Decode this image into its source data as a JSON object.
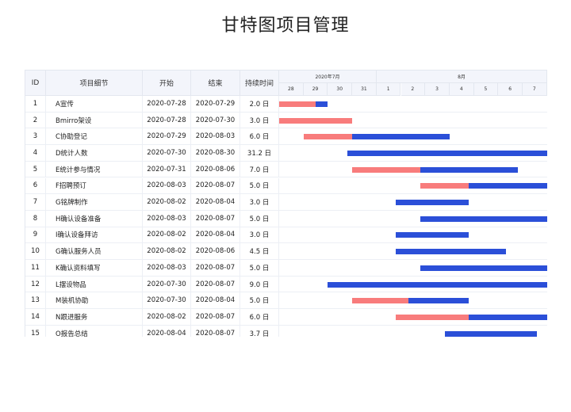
{
  "title": "甘特图项目管理",
  "columns": {
    "id": "ID",
    "detail": "项目细节",
    "start": "开始",
    "end": "结束",
    "duration": "持续时间"
  },
  "timeline": {
    "months": [
      {
        "label": "2020年7月",
        "days": [
          "28",
          "29",
          "30",
          "31"
        ]
      },
      {
        "label": "8月",
        "days": [
          "1",
          "2",
          "3",
          "4",
          "5",
          "6",
          "7"
        ]
      }
    ]
  },
  "colors": {
    "completed": "#f87c7c",
    "remaining": "#2b4fd8",
    "header_bg": "#f3f5fb"
  },
  "chart_data": {
    "type": "table",
    "rows": [
      {
        "id": "1",
        "name": "A宣传",
        "start": "2020-07-28",
        "end": "2020-07-29",
        "duration": "2.0 日",
        "done_until": "2020-07-29.5",
        "bar_start": "2020-07-28",
        "bar_end": "2020-07-30"
      },
      {
        "id": "2",
        "name": "Bmirro架设",
        "start": "2020-07-28",
        "end": "2020-07-30",
        "duration": "3.0 日",
        "done_until": "2020-07-31",
        "bar_start": "2020-07-28",
        "bar_end": "2020-07-31"
      },
      {
        "id": "3",
        "name": "C协助登记",
        "start": "2020-07-29",
        "end": "2020-08-03",
        "duration": "6.0 日",
        "done_until": "2020-07-31",
        "bar_start": "2020-07-29",
        "bar_end": "2020-08-04"
      },
      {
        "id": "4",
        "name": "D统计人数",
        "start": "2020-07-30",
        "end": "2020-08-30",
        "duration": "31.2 日",
        "done_until": null,
        "bar_start": "2020-07-30.8",
        "bar_end": "2020-08-08"
      },
      {
        "id": "5",
        "name": "E统计参与情况",
        "start": "2020-07-31",
        "end": "2020-08-06",
        "duration": "7.0 日",
        "done_until": "2020-08-02.8",
        "bar_start": "2020-07-31",
        "bar_end": "2020-08-06.8"
      },
      {
        "id": "6",
        "name": "F招聘预订",
        "start": "2020-08-03",
        "end": "2020-08-07",
        "duration": "5.0 日",
        "done_until": "2020-08-04.8",
        "bar_start": "2020-08-02.8",
        "bar_end": "2020-08-08"
      },
      {
        "id": "7",
        "name": "G铭牌制作",
        "start": "2020-08-02",
        "end": "2020-08-04",
        "duration": "3.0 日",
        "done_until": null,
        "bar_start": "2020-08-01.8",
        "bar_end": "2020-08-04.8"
      },
      {
        "id": "8",
        "name": "H确认设备准备",
        "start": "2020-08-03",
        "end": "2020-08-07",
        "duration": "5.0 日",
        "done_until": null,
        "bar_start": "2020-08-02.8",
        "bar_end": "2020-08-08"
      },
      {
        "id": "9",
        "name": "I确认设备拜访",
        "start": "2020-08-02",
        "end": "2020-08-04",
        "duration": "3.0 日",
        "done_until": null,
        "bar_start": "2020-08-01.8",
        "bar_end": "2020-08-04.8"
      },
      {
        "id": "10",
        "name": "G确认服务人员",
        "start": "2020-08-02",
        "end": "2020-08-06",
        "duration": "4.5 日",
        "done_until": null,
        "bar_start": "2020-08-01.8",
        "bar_end": "2020-08-06.3"
      },
      {
        "id": "11",
        "name": "K确认资料填写",
        "start": "2020-08-03",
        "end": "2020-08-07",
        "duration": "5.0 日",
        "done_until": null,
        "bar_start": "2020-08-02.8",
        "bar_end": "2020-08-08"
      },
      {
        "id": "12",
        "name": "L摆设物品",
        "start": "2020-07-30",
        "end": "2020-08-07",
        "duration": "9.0 日",
        "done_until": null,
        "bar_start": "2020-07-30",
        "bar_end": "2020-08-08"
      },
      {
        "id": "13",
        "name": "M装机协助",
        "start": "2020-07-30",
        "end": "2020-08-04",
        "duration": "5.0 日",
        "done_until": "2020-08-02.3",
        "bar_start": "2020-07-31",
        "bar_end": "2020-08-04.8"
      },
      {
        "id": "14",
        "name": "N跟进服务",
        "start": "2020-08-02",
        "end": "2020-08-07",
        "duration": "6.0 日",
        "done_until": "2020-08-04.8",
        "bar_start": "2020-08-01.8",
        "bar_end": "2020-08-08"
      },
      {
        "id": "15",
        "name": "O报告总结",
        "start": "2020-08-04",
        "end": "2020-08-07",
        "duration": "3.7 日",
        "done_until": null,
        "bar_start": "2020-08-03.8",
        "bar_end": "2020-08-07.6"
      }
    ]
  }
}
